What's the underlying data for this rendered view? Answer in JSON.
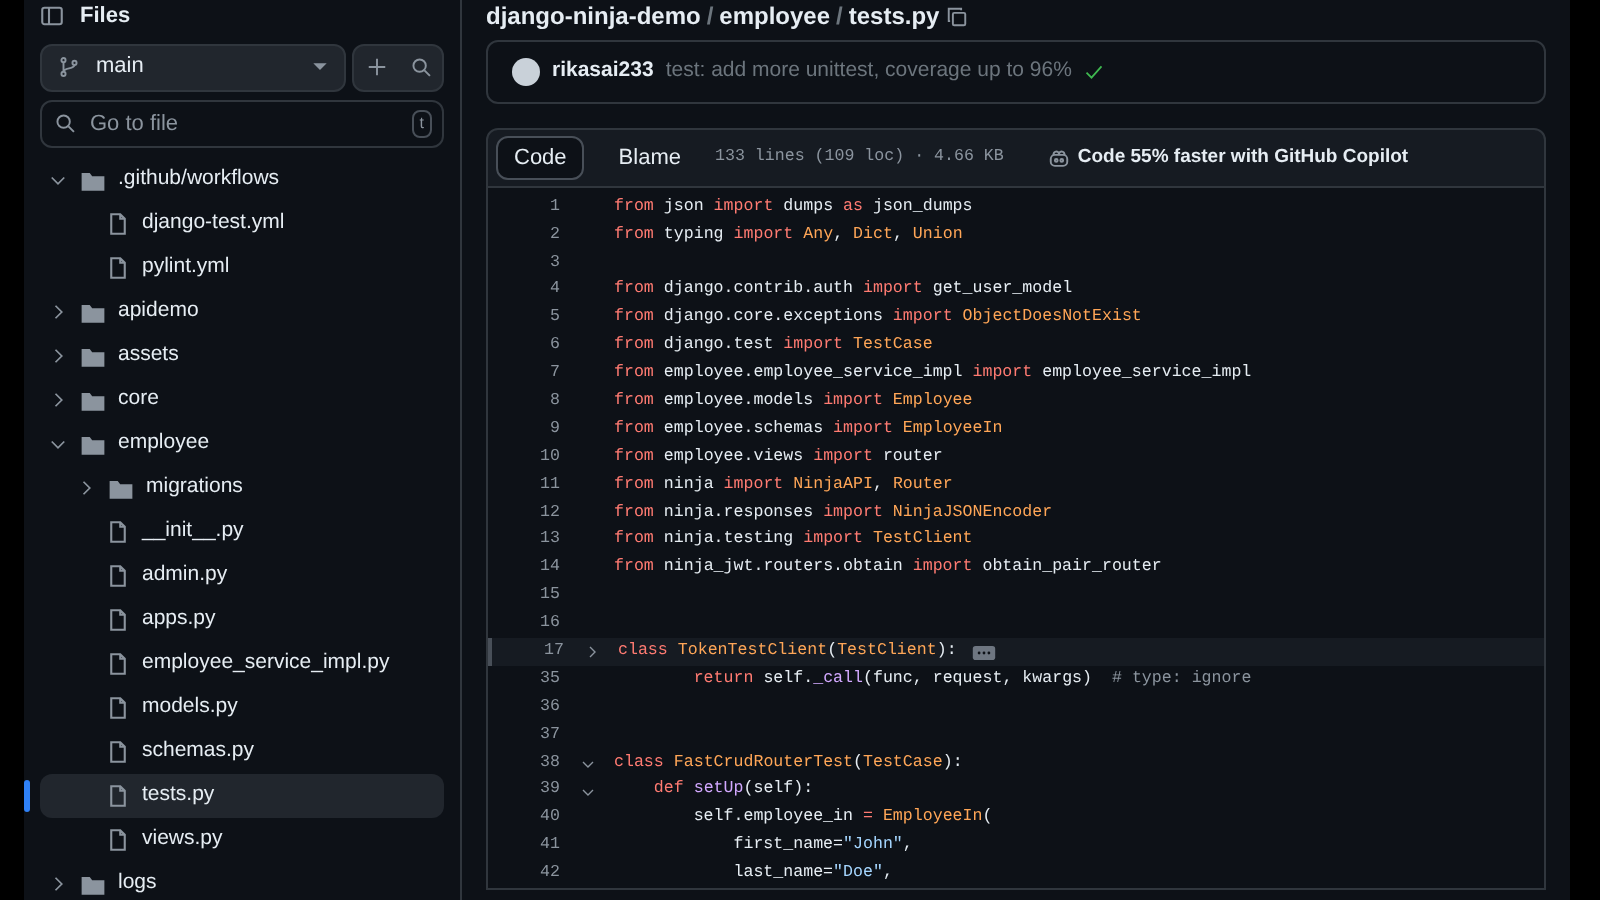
{
  "sidebar": {
    "title": "Files",
    "branch": "main",
    "search": {
      "placeholder": "Go to file",
      "shortcut": "t"
    },
    "tree": [
      {
        "kind": "folder",
        "name": ".github/workflows",
        "expanded": true,
        "selected": false,
        "children": [
          {
            "kind": "file",
            "name": "django-test.yml",
            "selected": false
          },
          {
            "kind": "file",
            "name": "pylint.yml",
            "selected": false
          }
        ]
      },
      {
        "kind": "folder",
        "name": "apidemo",
        "expanded": false,
        "selected": false
      },
      {
        "kind": "folder",
        "name": "assets",
        "expanded": false,
        "selected": false
      },
      {
        "kind": "folder",
        "name": "core",
        "expanded": false,
        "selected": false
      },
      {
        "kind": "folder",
        "name": "employee",
        "expanded": true,
        "selected": false,
        "children": [
          {
            "kind": "folder",
            "name": "migrations",
            "expanded": false,
            "selected": false
          },
          {
            "kind": "file",
            "name": "__init__.py",
            "selected": false
          },
          {
            "kind": "file",
            "name": "admin.py",
            "selected": false
          },
          {
            "kind": "file",
            "name": "apps.py",
            "selected": false
          },
          {
            "kind": "file",
            "name": "employee_service_impl.py",
            "selected": false
          },
          {
            "kind": "file",
            "name": "models.py",
            "selected": false
          },
          {
            "kind": "file",
            "name": "schemas.py",
            "selected": false
          },
          {
            "kind": "file",
            "name": "tests.py",
            "selected": true
          },
          {
            "kind": "file",
            "name": "views.py",
            "selected": false
          }
        ]
      },
      {
        "kind": "folder",
        "name": "logs",
        "expanded": false,
        "selected": false
      }
    ]
  },
  "breadcrumb": [
    {
      "kind": "link",
      "text": "django-ninja-demo"
    },
    {
      "kind": "separator",
      "text": "/"
    },
    {
      "kind": "link",
      "text": "employee"
    },
    {
      "kind": "separator",
      "text": "/"
    },
    {
      "kind": "current",
      "text": "tests.py"
    }
  ],
  "commit": {
    "author": "rikasai233",
    "message": "test: add more unittest, coverage up to 96%"
  },
  "toolbar": {
    "tabs": [
      {
        "label": "Code",
        "selected": true
      },
      {
        "label": "Blame",
        "selected": false
      }
    ],
    "info": "133 lines (109 loc) · 4.66 KB",
    "copilot": "Code 55% faster with GitHub Copilot"
  },
  "code": [
    {
      "num": "1",
      "tokens": [
        {
          "kind": "kw",
          "text": "from"
        },
        {
          "kind": "plain",
          "text": " json "
        },
        {
          "kind": "kw",
          "text": "import"
        },
        {
          "kind": "plain",
          "text": " dumps "
        },
        {
          "kind": "kw",
          "text": "as"
        },
        {
          "kind": "plain",
          "text": " json_dumps"
        }
      ]
    },
    {
      "num": "2",
      "tokens": [
        {
          "kind": "kw",
          "text": "from"
        },
        {
          "kind": "plain",
          "text": " typing "
        },
        {
          "kind": "kw",
          "text": "import"
        },
        {
          "kind": "cls",
          "text": " Any"
        },
        {
          "kind": "plain",
          "text": ", "
        },
        {
          "kind": "cls",
          "text": "Dict"
        },
        {
          "kind": "plain",
          "text": ", "
        },
        {
          "kind": "cls",
          "text": "Union"
        }
      ]
    },
    {
      "num": "3"
    },
    {
      "num": "4",
      "tokens": [
        {
          "kind": "kw",
          "text": "from"
        },
        {
          "kind": "plain",
          "text": " django.contrib.auth "
        },
        {
          "kind": "kw",
          "text": "import"
        },
        {
          "kind": "plain",
          "text": " get_user_model"
        }
      ]
    },
    {
      "num": "5",
      "tokens": [
        {
          "kind": "kw",
          "text": "from"
        },
        {
          "kind": "plain",
          "text": " django.core.exceptions "
        },
        {
          "kind": "kw",
          "text": "import"
        },
        {
          "kind": "cls",
          "text": " ObjectDoesNotExist"
        }
      ]
    },
    {
      "num": "6",
      "tokens": [
        {
          "kind": "kw",
          "text": "from"
        },
        {
          "kind": "plain",
          "text": " django.test "
        },
        {
          "kind": "kw",
          "text": "import"
        },
        {
          "kind": "cls",
          "text": " TestCase"
        }
      ]
    },
    {
      "num": "7",
      "tokens": [
        {
          "kind": "kw",
          "text": "from"
        },
        {
          "kind": "plain",
          "text": " employee.employee_service_impl "
        },
        {
          "kind": "kw",
          "text": "import"
        },
        {
          "kind": "plain",
          "text": " employee_service_impl"
        }
      ]
    },
    {
      "num": "8",
      "tokens": [
        {
          "kind": "kw",
          "text": "from"
        },
        {
          "kind": "plain",
          "text": " employee.models "
        },
        {
          "kind": "kw",
          "text": "import"
        },
        {
          "kind": "cls",
          "text": " Employee"
        }
      ]
    },
    {
      "num": "9",
      "tokens": [
        {
          "kind": "kw",
          "text": "from"
        },
        {
          "kind": "plain",
          "text": " employee.schemas "
        },
        {
          "kind": "kw",
          "text": "import"
        },
        {
          "kind": "cls",
          "text": " EmployeeIn"
        }
      ]
    },
    {
      "num": "10",
      "tokens": [
        {
          "kind": "kw",
          "text": "from"
        },
        {
          "kind": "plain",
          "text": " employee.views "
        },
        {
          "kind": "kw",
          "text": "import"
        },
        {
          "kind": "plain",
          "text": " router"
        }
      ]
    },
    {
      "num": "11",
      "tokens": [
        {
          "kind": "kw",
          "text": "from"
        },
        {
          "kind": "plain",
          "text": " ninja "
        },
        {
          "kind": "kw",
          "text": "import"
        },
        {
          "kind": "cls",
          "text": " NinjaAPI"
        },
        {
          "kind": "plain",
          "text": ", "
        },
        {
          "kind": "cls",
          "text": "Router"
        }
      ]
    },
    {
      "num": "12",
      "tokens": [
        {
          "kind": "kw",
          "text": "from"
        },
        {
          "kind": "plain",
          "text": " ninja.responses "
        },
        {
          "kind": "kw",
          "text": "import"
        },
        {
          "kind": "cls",
          "text": " NinjaJSONEncoder"
        }
      ]
    },
    {
      "num": "13",
      "tokens": [
        {
          "kind": "kw",
          "text": "from"
        },
        {
          "kind": "plain",
          "text": " ninja.testing "
        },
        {
          "kind": "kw",
          "text": "import"
        },
        {
          "kind": "cls",
          "text": " TestClient"
        }
      ]
    },
    {
      "num": "14",
      "tokens": [
        {
          "kind": "kw",
          "text": "from"
        },
        {
          "kind": "plain",
          "text": " ninja_jwt.routers.obtain "
        },
        {
          "kind": "kw",
          "text": "import"
        },
        {
          "kind": "plain",
          "text": " obtain_pair_router"
        }
      ]
    },
    {
      "num": "15"
    },
    {
      "num": "16"
    },
    {
      "num": "17",
      "foldable": true,
      "folded": true,
      "highlighted": true,
      "tokens": [
        {
          "kind": "kw",
          "text": "class"
        },
        {
          "kind": "cls",
          "text": " TokenTestClient"
        },
        {
          "kind": "plain",
          "text": "("
        },
        {
          "kind": "cls",
          "text": "TestClient"
        },
        {
          "kind": "plain",
          "text": "):"
        }
      ]
    },
    {
      "num": "35",
      "tokens": [
        {
          "kind": "kw",
          "text": "        return"
        },
        {
          "kind": "plain",
          "text": " self."
        },
        {
          "kind": "fn",
          "text": "_call"
        },
        {
          "kind": "plain",
          "text": "(func, request, kwargs)  "
        },
        {
          "kind": "cmt",
          "text": "# type: ignore"
        }
      ]
    },
    {
      "num": "36"
    },
    {
      "num": "37"
    },
    {
      "num": "38",
      "foldable": true,
      "folded": false,
      "tokens": [
        {
          "kind": "kw",
          "text": "class"
        },
        {
          "kind": "cls",
          "text": " FastCrudRouterTest"
        },
        {
          "kind": "plain",
          "text": "("
        },
        {
          "kind": "cls",
          "text": "TestCase"
        },
        {
          "kind": "plain",
          "text": "):"
        }
      ]
    },
    {
      "num": "39",
      "foldable": true,
      "folded": false,
      "tokens": [
        {
          "kind": "kw",
          "text": "    def"
        },
        {
          "kind": "fn",
          "text": " setUp"
        },
        {
          "kind": "plain",
          "text": "(self):"
        }
      ]
    },
    {
      "num": "40",
      "tokens": [
        {
          "kind": "plain",
          "text": "        self.employee_in "
        },
        {
          "kind": "kw",
          "text": "="
        },
        {
          "kind": "cls",
          "text": " EmployeeIn"
        },
        {
          "kind": "plain",
          "text": "("
        }
      ]
    },
    {
      "num": "41",
      "tokens": [
        {
          "kind": "plain",
          "text": "            first_name="
        },
        {
          "kind": "str",
          "text": "\"John\""
        },
        {
          "kind": "plain",
          "text": ","
        }
      ]
    },
    {
      "num": "42",
      "tokens": [
        {
          "kind": "plain",
          "text": "            last_name="
        },
        {
          "kind": "str",
          "text": "\"Doe\""
        },
        {
          "kind": "plain",
          "text": ","
        }
      ]
    }
  ]
}
